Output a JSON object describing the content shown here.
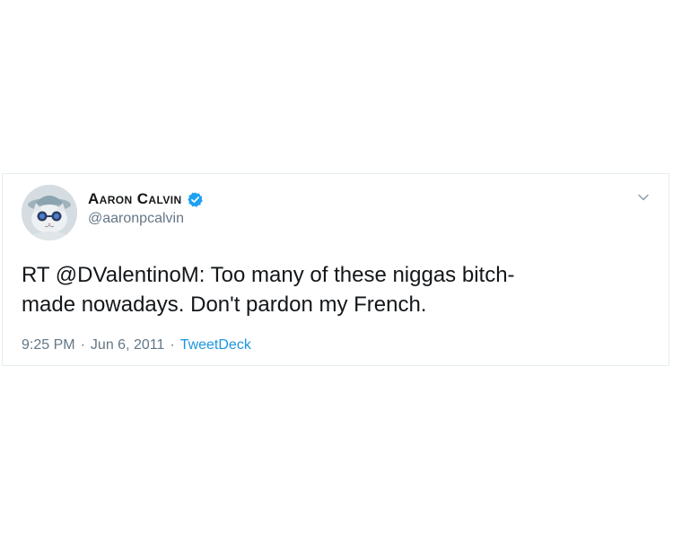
{
  "tweet": {
    "author": {
      "display_name": "Aaron Calvin",
      "handle": "@aaronpcalvin",
      "verified": true,
      "avatar": "cat-with-sunglasses-avatar"
    },
    "text_line_1": "RT @DValentinoM: Too many of these niggas bitch-",
    "text_line_2": "made nowadays. Don't pardon my French.",
    "time": "9:25 PM",
    "separator_1": "·",
    "date": "Jun 6, 2011",
    "separator_2": "·",
    "source": "TweetDeck",
    "menu_icon": "chevron-down-icon"
  },
  "colors": {
    "name": "#14171a",
    "secondary_text": "#657786",
    "link": "#1b95e0",
    "verified_badge": "#1da1f2",
    "card_border": "#e6ecf0"
  }
}
